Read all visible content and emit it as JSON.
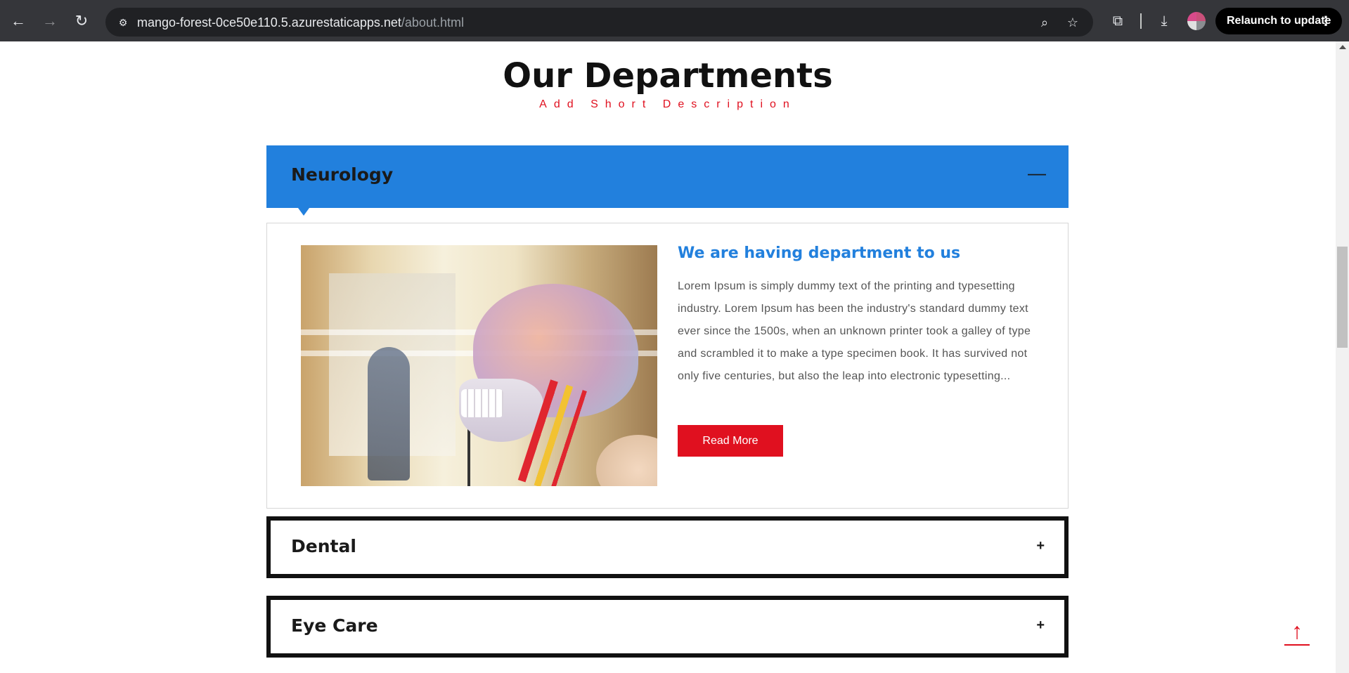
{
  "browser": {
    "url_host": "mango-forest-0ce50e110.5.azurestaticapps.net",
    "url_path": "/about.html",
    "relaunch_label": "Relaunch to update",
    "icons": {
      "back": "back-arrow-icon",
      "forward": "forward-arrow-icon",
      "reload": "reload-icon",
      "site_info": "site-info-icon",
      "zoom": "zoom-icon",
      "bookmark": "star-icon",
      "extensions": "puzzle-icon",
      "downloads": "download-icon",
      "menu": "kebab-menu-icon"
    }
  },
  "section": {
    "title": "Our Departments",
    "description": "Add Short Description"
  },
  "accordion": {
    "active": {
      "title": "Neurology",
      "toggle": "—",
      "heading": "We are having department to us",
      "text": "Lorem Ipsum is simply dummy text of the printing and typesetting industry. Lorem Ipsum has been the industry's standard dummy text ever since the 1500s, when an unknown printer took a galley of type and scrambled it to make a type specimen book. It has survived not only five centuries, but also the leap into electronic typesetting...",
      "button_label": "Read More"
    },
    "collapsed": [
      {
        "title": "Dental",
        "toggle": "+"
      },
      {
        "title": "Eye Care",
        "toggle": "+"
      }
    ]
  },
  "back_to_top": {
    "symbol": "↑"
  },
  "colors": {
    "accent_blue": "#2280dd",
    "accent_red": "#e0101f",
    "chrome_bg": "#35363a"
  }
}
